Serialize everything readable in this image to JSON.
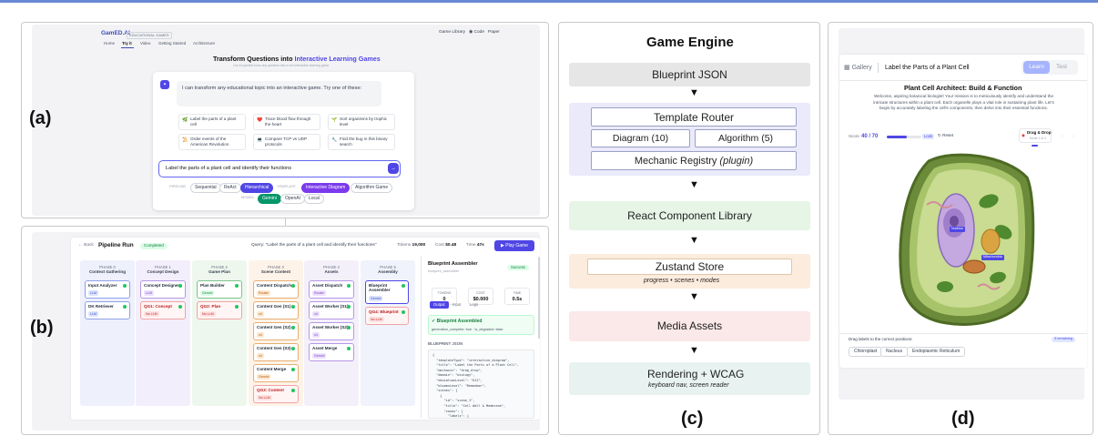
{
  "labels": {
    "a": "(a)",
    "b": "(b)",
    "c": "(c)",
    "d": "(d)"
  },
  "a": {
    "brand": "GamED.AI",
    "brand_tag": "EDUCATIONAL GAMES",
    "nav": [
      "Home",
      "Try it",
      "Video",
      "Getting Started",
      "Architecture"
    ],
    "right_nav": [
      "Game Library",
      "Code",
      "Paper"
    ],
    "hero_prefix": "Transform Questions into ",
    "hero_accent": "Interactive Learning Games",
    "hero_sub": "Our AI pipeline turns any question into a rich interactive learning game",
    "assistant_msg": "I can transform any educational topic into an interactive game. Try one of these:",
    "suggestions": [
      {
        "icon": "🌿",
        "text": "Label the parts of a plant cell"
      },
      {
        "icon": "❤️",
        "text": "Trace blood flow through the heart"
      },
      {
        "icon": "🌱",
        "text": "Sort organisms by trophic level"
      },
      {
        "icon": "📜",
        "text": "Order events of the American Revolution"
      },
      {
        "icon": "💻",
        "text": "Compare TCP vs UDP protocols"
      },
      {
        "icon": "🔧",
        "text": "Find the bug in this binary search"
      }
    ],
    "input": "Label the parts of a plant cell and identify their functions",
    "pipeline_label": "PIPELINE",
    "pipeline": [
      "Sequential",
      "ReAct",
      "Hierarchical"
    ],
    "template_label": "TEMPLATE",
    "template": [
      "Interactive Diagram",
      "Algorithm Game"
    ],
    "model_label": "MODEL",
    "model": [
      "Gemini",
      "OpenAI",
      "Local"
    ]
  },
  "b": {
    "back": "← Back",
    "title": "Pipeline Run",
    "status": "Completed",
    "query": "Query: \"Label the parts of a plant cell and identify their functions\"",
    "tokens_label": "Tokens",
    "tokens": "19,000",
    "cost_label": "Cost",
    "cost": "$0.48",
    "time_label": "Time",
    "time": "47s",
    "play": "▶ Play Game",
    "phases": [
      {
        "n": "PHASE 0",
        "t": "Context Gathering"
      },
      {
        "n": "PHASE 1",
        "t": "Concept Design"
      },
      {
        "n": "PHASE 2",
        "t": "Game Plan"
      },
      {
        "n": "PHASE 3",
        "t": "Scene Content"
      },
      {
        "n": "PHASE 4",
        "t": "Assets"
      },
      {
        "n": "PHASE 5",
        "t": "Assembly"
      }
    ],
    "nodes": [
      {
        "c": 0,
        "r": 0,
        "t": "Input Analyzer",
        "s": "LLM"
      },
      {
        "c": 0,
        "r": 1,
        "t": "DK Retriever",
        "s": "LLM"
      },
      {
        "c": 1,
        "r": 0,
        "t": "Concept Designer",
        "s": "LLM"
      },
      {
        "c": 1,
        "r": 1,
        "t": "QG1: Concept",
        "s": "No LLM"
      },
      {
        "c": 2,
        "r": 0,
        "t": "Plan Builder",
        "s": "Gemini"
      },
      {
        "c": 2,
        "r": 1,
        "t": "QG2: Plan",
        "s": "No LLM"
      },
      {
        "c": 3,
        "r": 0,
        "t": "Content Dispatch",
        "s": "Router"
      },
      {
        "c": 3,
        "r": 1,
        "t": "Content Gen (S1)",
        "s": "x4"
      },
      {
        "c": 3,
        "r": 2,
        "t": "Content Gen (S2)",
        "s": "x4"
      },
      {
        "c": 3,
        "r": 3,
        "t": "Content Gen (S3)",
        "s": "x4"
      },
      {
        "c": 3,
        "r": 4,
        "t": "Content Merge",
        "s": "Gemini"
      },
      {
        "c": 3,
        "r": 5,
        "t": "QG3: Content",
        "s": "No LLM"
      },
      {
        "c": 4,
        "r": 0,
        "t": "Asset Dispatch",
        "s": "Router"
      },
      {
        "c": 4,
        "r": 1,
        "t": "Asset Worker (S1)",
        "s": "x4"
      },
      {
        "c": 4,
        "r": 2,
        "t": "Asset Worker (S2)",
        "s": "x4"
      },
      {
        "c": 4,
        "r": 3,
        "t": "Asset Merge",
        "s": "Gemini"
      },
      {
        "c": 5,
        "r": 0,
        "t": "Blueprint Assembler",
        "s": "Gemini"
      },
      {
        "c": 5,
        "r": 1,
        "t": "QG4: Blueprint",
        "s": "No LLM"
      }
    ],
    "detail_title": "Blueprint Assembler",
    "detail_sub": "blueprint_assembler",
    "detail_status": "Success",
    "stats": [
      {
        "l": "TOKENS",
        "v": "0"
      },
      {
        "l": "COST",
        "v": "$0.000"
      },
      {
        "l": "TIME",
        "v": "0.5s"
      }
    ],
    "tabs": [
      "Output",
      "Input",
      "Logs"
    ],
    "assembled": "Blueprint Assembled",
    "assembled_sub": "generation_complete: true · is_degraded: false",
    "json_label": "BLUEPRINT JSON",
    "json_lines": [
      "{",
      "  \"templateType\": \"interactive_diagram\",",
      "  \"title\": \"Label the Parts of a Plant Cell\",",
      "  \"mechanic\": \"drag_drop\",",
      "  \"domain\": \"biology\",",
      "  \"educationLevel\": \"K12\",",
      "  \"bloomsLevel\": \"Remember\",",
      "  \"scenes\": [",
      "    {",
      "      \"id\": \"scene_1\",",
      "      \"title\": \"Cell Wall & Membrane\",",
      "      \"zones\": [",
      "        \"labels\": {"
    ]
  },
  "c": {
    "title": "Game Engine",
    "blueprint": "Blueprint JSON",
    "router": "Template Router",
    "diagram": "Diagram (10)",
    "algorithm": "Algorithm (5)",
    "registry": "Mechanic Registry",
    "registry_note": "(plugin)",
    "react": "React Component Library",
    "zustand": "Zustand Store",
    "zustand_sub": "progress • scenes • modes",
    "media": "Media Assets",
    "render": "Rendering + WCAG",
    "render_sub": "keyboard nav, screen reader"
  },
  "d": {
    "gallery": "Gallery",
    "header_title": "Label the Parts of a Plant Cell",
    "learn": "Learn",
    "test": "Test",
    "game_title": "Plant Cell Architect: Build & Function",
    "intro": "Welcome, aspiring botanical biologist! Your mission is to meticulously identify and understand the intricate structures within a plant cell. Each organelle plays a vital role in sustaining plant life. Let's begin by accurately labeling the cell's components, then delve into their essential functions.",
    "score_label": "Score",
    "score": "40 / 70",
    "level": "Look",
    "reset": "Reset",
    "mode": "Drag & Drop",
    "mode_sub": "Mode 1 of 4",
    "lbl_nucleus": "Nucleus",
    "lbl_mito": "Mitochondria",
    "drag_hint": "Drag labels to the correct positions:",
    "remaining": "3 remaining",
    "labels": [
      "Chloroplast",
      "Nucleus",
      "Endoplasmic Reticulum"
    ]
  }
}
